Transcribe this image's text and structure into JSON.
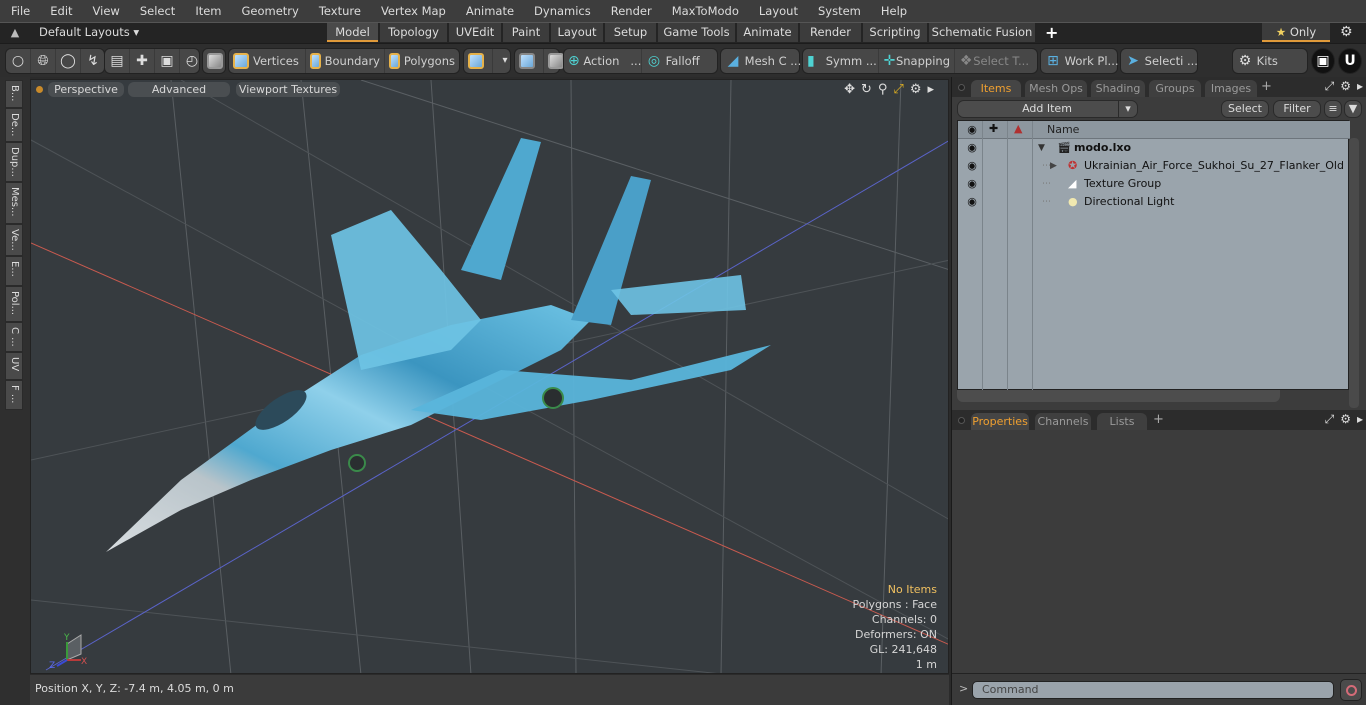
{
  "menubar": {
    "items": [
      "File",
      "Edit",
      "View",
      "Select",
      "Item",
      "Geometry",
      "Texture",
      "Vertex Map",
      "Animate",
      "Dynamics",
      "Render",
      "MaxToModo",
      "Layout",
      "System",
      "Help"
    ]
  },
  "layoutbar": {
    "layouts_dropdown": "Default Layouts",
    "tabs": [
      "Model",
      "Topology",
      "UVEdit",
      "Paint",
      "Layout",
      "Setup",
      "Game Tools",
      "Animate",
      "Render",
      "Scripting",
      "Schematic Fusion"
    ],
    "active_tab": "Model",
    "add_tab": "+",
    "only_label": "Only"
  },
  "toolbar": {
    "vertices": "Vertices",
    "boundary": "Boundary",
    "polygons": "Polygons",
    "action": "Action",
    "action_more": "...",
    "falloff": "Falloff",
    "mesh_c": "Mesh C ...",
    "symm": "Symm ...",
    "snapping": "Snapping",
    "select_t": "Select T...",
    "work_pl": "Work Pl...",
    "selecti": "Selecti ...",
    "kits": "Kits"
  },
  "left_strip": {
    "tabs": [
      "B...",
      "De...",
      "Dup...",
      "Mes...",
      "Ve...",
      "E...",
      "Pol...",
      "C ...",
      "UV",
      "F ..."
    ]
  },
  "viewport": {
    "view_mode": "Perspective",
    "shading": "Advanced",
    "textures": "Viewport Textures",
    "stats": {
      "no_items": "No Items",
      "polygons": "Polygons : Face",
      "channels": "Channels: 0",
      "deformers": "Deformers: ON",
      "gl": "GL: 241,648",
      "scale": "1 m"
    },
    "axis_labels": {
      "y": "Y",
      "z": "Z",
      "x": "X"
    }
  },
  "statusbar": {
    "position": "Position X, Y, Z:   -7.4 m, 4.05 m, 0 m"
  },
  "items_panel": {
    "tabs": [
      "Items",
      "Mesh Ops",
      "Shading",
      "Groups",
      "Images"
    ],
    "active_tab": "Items",
    "add_item": "Add Item",
    "select": "Select",
    "filter": "Filter",
    "column_name": "Name",
    "rows": [
      {
        "name": "modo.lxo",
        "bold": true
      },
      {
        "name": "Ukrainian_Air_Force_Sukhoi_Su_27_Flanker_Old"
      },
      {
        "name": "Texture Group"
      },
      {
        "name": "Directional Light"
      }
    ]
  },
  "properties_panel": {
    "tabs": [
      "Properties",
      "Channels",
      "Lists"
    ],
    "active_tab": "Properties"
  },
  "command": {
    "prompt": ">",
    "placeholder": "Command"
  },
  "colors": {
    "accent": "#e09a3a",
    "active_tab_text": "#f0a030",
    "x_axis": "#d9473b",
    "z_axis": "#4a5bd6"
  }
}
